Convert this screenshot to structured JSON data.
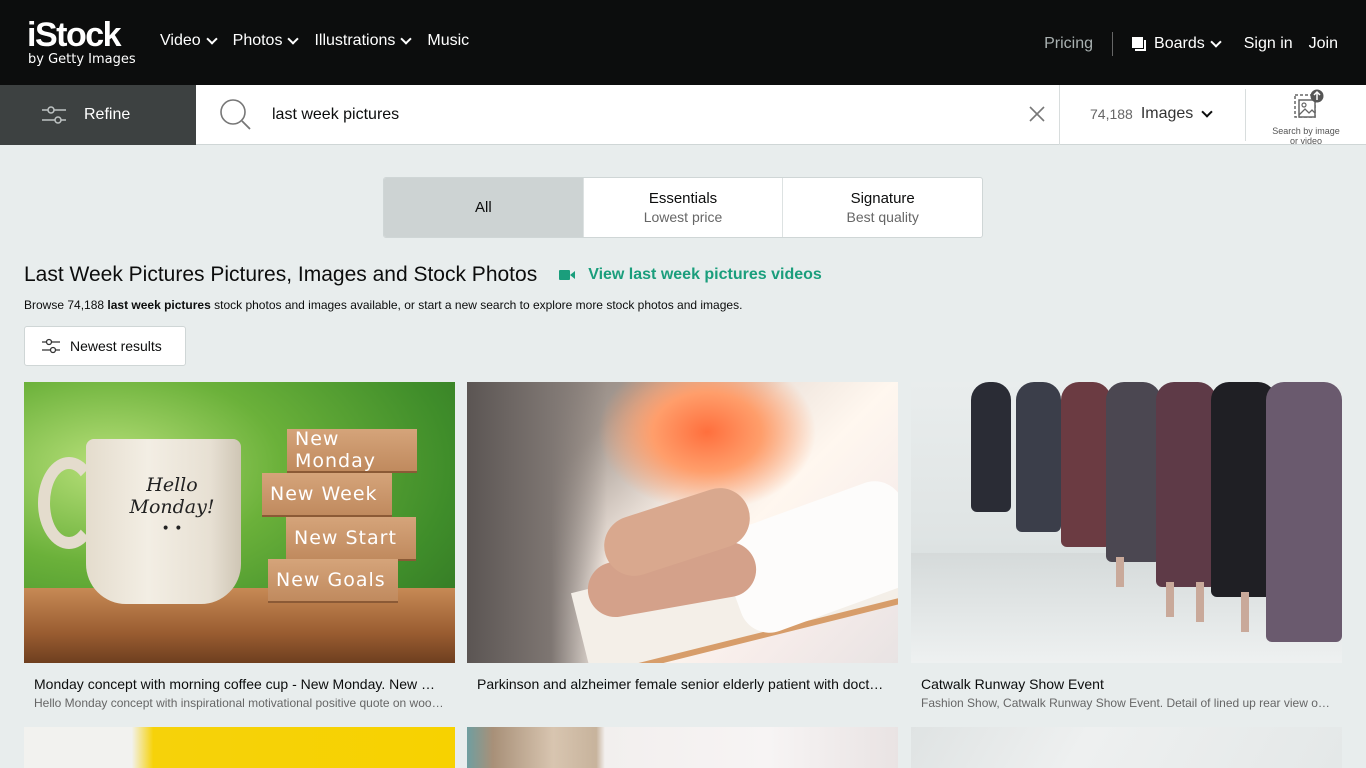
{
  "header": {
    "logo": {
      "main": "iStock",
      "sub": "by Getty Images"
    },
    "nav": [
      {
        "label": "Video",
        "has_dropdown": true
      },
      {
        "label": "Photos",
        "has_dropdown": true
      },
      {
        "label": "Illustrations",
        "has_dropdown": true
      },
      {
        "label": "Music",
        "has_dropdown": false
      }
    ],
    "pricing": "Pricing",
    "boards": "Boards",
    "sign_in": "Sign in",
    "join": "Join"
  },
  "search": {
    "refine_label": "Refine",
    "query": "last week pictures",
    "result_count": "74,188",
    "media_type": "Images",
    "search_by_image_label_1": "Search by image",
    "search_by_image_label_2": "or video"
  },
  "tabs": [
    {
      "title": "All",
      "subtitle": "",
      "active": true
    },
    {
      "title": "Essentials",
      "subtitle": "Lowest price",
      "active": false
    },
    {
      "title": "Signature",
      "subtitle": "Best quality",
      "active": false
    }
  ],
  "page": {
    "title": "Last Week Pictures Pictures, Images and Stock Photos",
    "video_link": "View last week pictures videos",
    "browse_prefix": "Browse 74,188 ",
    "browse_term": "last week pictures",
    "browse_suffix": " stock photos and images available, or start a new search to explore more stock photos and images.",
    "sort_label": "Newest results"
  },
  "results": [
    {
      "title": "Monday concept with morning coffee cup - New Monday. New Week. New Start. New Goals.",
      "description": "Hello Monday concept with inspirational motivational positive quote on wooden blocks",
      "image_text": {
        "mug_line1": "Hello",
        "mug_line2": "Monday!",
        "smiley": "• •",
        "blocks": [
          "New Monday",
          "New Week",
          "New Start",
          "New Goals"
        ]
      }
    },
    {
      "title": "Parkinson and alzheimer female senior elderly patient with doctor hands",
      "description": ""
    },
    {
      "title": "Catwalk Runway Show Event",
      "description": "Fashion Show, Catwalk Runway Show Event. Detail of lined up rear view of models"
    },
    {
      "title": "",
      "description": ""
    },
    {
      "title": "",
      "description": ""
    },
    {
      "title": "",
      "description": ""
    }
  ],
  "colors": {
    "nav_bg": "#0c0d0d",
    "refine_bg": "#3d4141",
    "page_bg": "#e8eded",
    "accent_green": "#1a9e7c",
    "active_tab": "#cdd3d3"
  }
}
